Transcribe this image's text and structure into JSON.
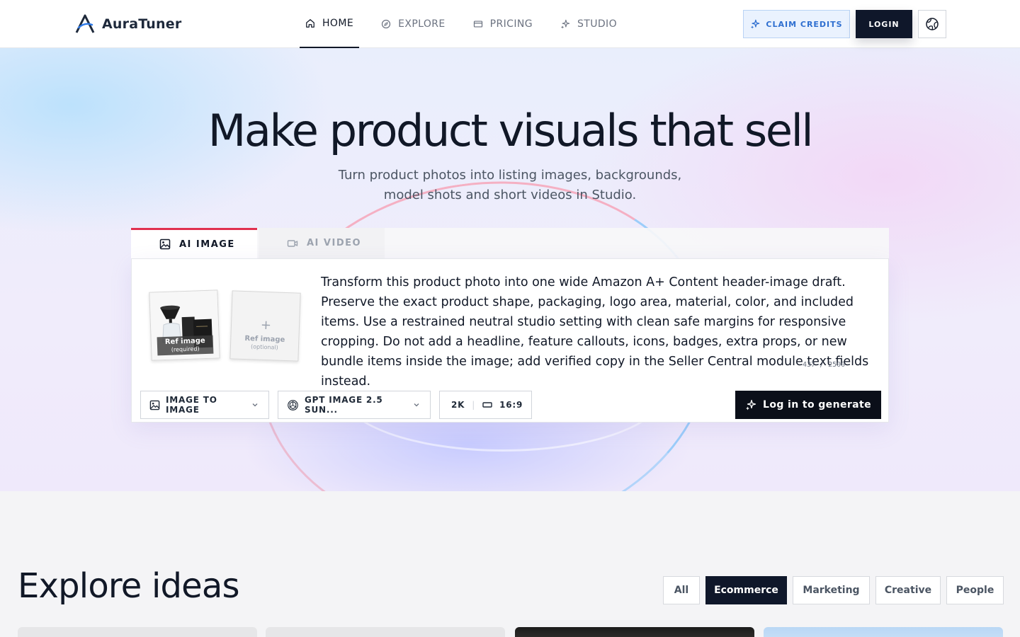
{
  "brand": {
    "name": "AuraTuner"
  },
  "nav": {
    "items": [
      {
        "label": "HOME",
        "icon": "home-icon",
        "active": true
      },
      {
        "label": "EXPLORE",
        "icon": "compass-icon",
        "active": false
      },
      {
        "label": "PRICING",
        "icon": "card-icon",
        "active": false
      },
      {
        "label": "STUDIO",
        "icon": "sparkles-icon",
        "active": false
      }
    ]
  },
  "header": {
    "claim_label": "CLAIM CREDITS",
    "login_label": "LOGIN",
    "lang_icon": "globe-icon"
  },
  "hero": {
    "title": "Make product visuals that sell",
    "subtitle": "Turn product photos into listing images, backgrounds, model shots and short videos in Studio."
  },
  "tabs": [
    {
      "label": "AI IMAGE",
      "active": true
    },
    {
      "label": "AI VIDEO",
      "active": false
    }
  ],
  "composer": {
    "ref1": {
      "label": "Ref image",
      "sub": "(required)"
    },
    "ref2": {
      "plus": "+",
      "label": "Ref image",
      "sub": "(optional)"
    },
    "prompt": "Transform this product photo into one wide Amazon A+ Content header-image draft. Preserve the exact product shape, packaging, logo area, material, color, and included items. Use a restrained neutral studio setting with clean safe margins for responsive cropping. Do not add a headline, feature callouts, icons, badges, extra props, or new bundle items inside the image; add verified copy in the Seller Central module text fields instead.",
    "counter": "437 / 2500",
    "mode": "IMAGE TO IMAGE",
    "model": "GPT IMAGE 2.5 SUN...",
    "resolution": "2K",
    "aspect": "16:9",
    "generate_label": "Log in to generate"
  },
  "explore": {
    "title": "Explore ideas",
    "filters": [
      {
        "label": "All",
        "active": false
      },
      {
        "label": "Ecommerce",
        "active": true
      },
      {
        "label": "Marketing",
        "active": false
      },
      {
        "label": "Creative",
        "active": false
      },
      {
        "label": "People",
        "active": false
      }
    ]
  },
  "colors": {
    "accent_tab": "#e0304f",
    "primary_dark": "#0f172a",
    "claim_blue": "#2f6fd0"
  }
}
